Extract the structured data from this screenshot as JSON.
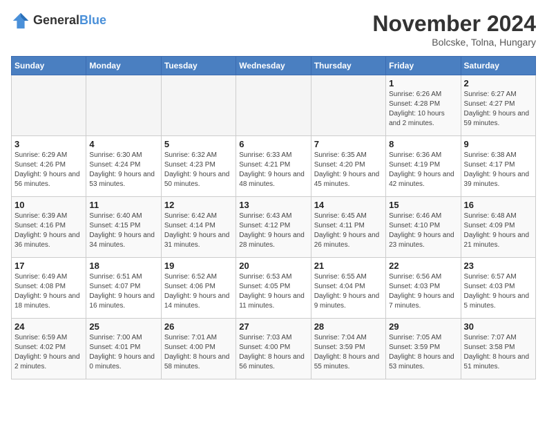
{
  "logo": {
    "line1": "General",
    "line2": "Blue"
  },
  "header": {
    "title": "November 2024",
    "subtitle": "Bolcske, Tolna, Hungary"
  },
  "weekdays": [
    "Sunday",
    "Monday",
    "Tuesday",
    "Wednesday",
    "Thursday",
    "Friday",
    "Saturday"
  ],
  "weeks": [
    [
      {
        "day": "",
        "info": ""
      },
      {
        "day": "",
        "info": ""
      },
      {
        "day": "",
        "info": ""
      },
      {
        "day": "",
        "info": ""
      },
      {
        "day": "",
        "info": ""
      },
      {
        "day": "1",
        "info": "Sunrise: 6:26 AM\nSunset: 4:28 PM\nDaylight: 10 hours\nand 2 minutes."
      },
      {
        "day": "2",
        "info": "Sunrise: 6:27 AM\nSunset: 4:27 PM\nDaylight: 9 hours\nand 59 minutes."
      }
    ],
    [
      {
        "day": "3",
        "info": "Sunrise: 6:29 AM\nSunset: 4:26 PM\nDaylight: 9 hours\nand 56 minutes."
      },
      {
        "day": "4",
        "info": "Sunrise: 6:30 AM\nSunset: 4:24 PM\nDaylight: 9 hours\nand 53 minutes."
      },
      {
        "day": "5",
        "info": "Sunrise: 6:32 AM\nSunset: 4:23 PM\nDaylight: 9 hours\nand 50 minutes."
      },
      {
        "day": "6",
        "info": "Sunrise: 6:33 AM\nSunset: 4:21 PM\nDaylight: 9 hours\nand 48 minutes."
      },
      {
        "day": "7",
        "info": "Sunrise: 6:35 AM\nSunset: 4:20 PM\nDaylight: 9 hours\nand 45 minutes."
      },
      {
        "day": "8",
        "info": "Sunrise: 6:36 AM\nSunset: 4:19 PM\nDaylight: 9 hours\nand 42 minutes."
      },
      {
        "day": "9",
        "info": "Sunrise: 6:38 AM\nSunset: 4:17 PM\nDaylight: 9 hours\nand 39 minutes."
      }
    ],
    [
      {
        "day": "10",
        "info": "Sunrise: 6:39 AM\nSunset: 4:16 PM\nDaylight: 9 hours\nand 36 minutes."
      },
      {
        "day": "11",
        "info": "Sunrise: 6:40 AM\nSunset: 4:15 PM\nDaylight: 9 hours\nand 34 minutes."
      },
      {
        "day": "12",
        "info": "Sunrise: 6:42 AM\nSunset: 4:14 PM\nDaylight: 9 hours\nand 31 minutes."
      },
      {
        "day": "13",
        "info": "Sunrise: 6:43 AM\nSunset: 4:12 PM\nDaylight: 9 hours\nand 28 minutes."
      },
      {
        "day": "14",
        "info": "Sunrise: 6:45 AM\nSunset: 4:11 PM\nDaylight: 9 hours\nand 26 minutes."
      },
      {
        "day": "15",
        "info": "Sunrise: 6:46 AM\nSunset: 4:10 PM\nDaylight: 9 hours\nand 23 minutes."
      },
      {
        "day": "16",
        "info": "Sunrise: 6:48 AM\nSunset: 4:09 PM\nDaylight: 9 hours\nand 21 minutes."
      }
    ],
    [
      {
        "day": "17",
        "info": "Sunrise: 6:49 AM\nSunset: 4:08 PM\nDaylight: 9 hours\nand 18 minutes."
      },
      {
        "day": "18",
        "info": "Sunrise: 6:51 AM\nSunset: 4:07 PM\nDaylight: 9 hours\nand 16 minutes."
      },
      {
        "day": "19",
        "info": "Sunrise: 6:52 AM\nSunset: 4:06 PM\nDaylight: 9 hours\nand 14 minutes."
      },
      {
        "day": "20",
        "info": "Sunrise: 6:53 AM\nSunset: 4:05 PM\nDaylight: 9 hours\nand 11 minutes."
      },
      {
        "day": "21",
        "info": "Sunrise: 6:55 AM\nSunset: 4:04 PM\nDaylight: 9 hours\nand 9 minutes."
      },
      {
        "day": "22",
        "info": "Sunrise: 6:56 AM\nSunset: 4:03 PM\nDaylight: 9 hours\nand 7 minutes."
      },
      {
        "day": "23",
        "info": "Sunrise: 6:57 AM\nSunset: 4:03 PM\nDaylight: 9 hours\nand 5 minutes."
      }
    ],
    [
      {
        "day": "24",
        "info": "Sunrise: 6:59 AM\nSunset: 4:02 PM\nDaylight: 9 hours\nand 2 minutes."
      },
      {
        "day": "25",
        "info": "Sunrise: 7:00 AM\nSunset: 4:01 PM\nDaylight: 9 hours\nand 0 minutes."
      },
      {
        "day": "26",
        "info": "Sunrise: 7:01 AM\nSunset: 4:00 PM\nDaylight: 8 hours\nand 58 minutes."
      },
      {
        "day": "27",
        "info": "Sunrise: 7:03 AM\nSunset: 4:00 PM\nDaylight: 8 hours\nand 56 minutes."
      },
      {
        "day": "28",
        "info": "Sunrise: 7:04 AM\nSunset: 3:59 PM\nDaylight: 8 hours\nand 55 minutes."
      },
      {
        "day": "29",
        "info": "Sunrise: 7:05 AM\nSunset: 3:59 PM\nDaylight: 8 hours\nand 53 minutes."
      },
      {
        "day": "30",
        "info": "Sunrise: 7:07 AM\nSunset: 3:58 PM\nDaylight: 8 hours\nand 51 minutes."
      }
    ]
  ]
}
